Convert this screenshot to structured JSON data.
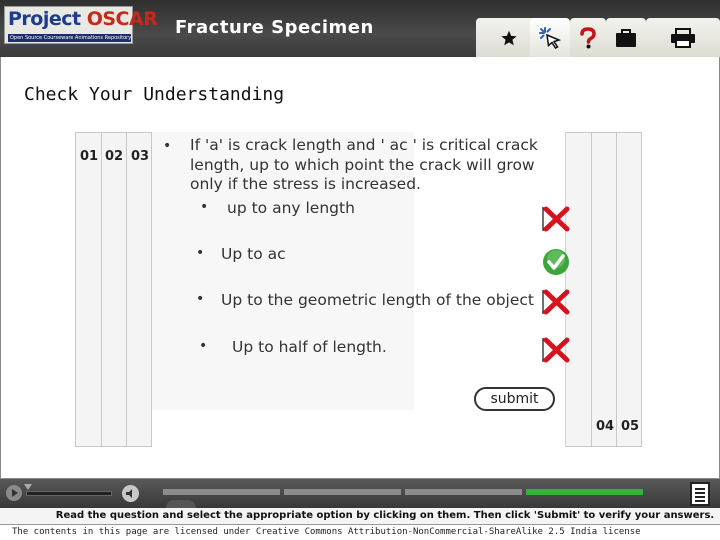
{
  "header": {
    "logo": {
      "word1": "Project",
      "word2": "OSCAR",
      "tagline": "Open Source Courseware Animations Repository"
    },
    "title": "Fracture Specimen",
    "tabs": [
      {
        "icon": "star-icon"
      },
      {
        "icon": "cursor-click-icon"
      },
      {
        "icon": "question-icon"
      },
      {
        "icon": "briefcase-icon"
      },
      {
        "icon": "printer-icon"
      }
    ]
  },
  "section_title": "Check Your Understanding",
  "question_tabs": {
    "left": [
      "01",
      "02",
      "03"
    ],
    "right": [
      "04",
      "05"
    ]
  },
  "question": {
    "text": "If 'a' is crack length and ' ac ' is critical crack length, up to which  point the crack will grow only if the stress is  increased.",
    "options": [
      {
        "label": "up to any length",
        "result": "wrong"
      },
      {
        "label": "Up to ac",
        "result": "correct"
      },
      {
        "label": "Up to the geometric length of the object",
        "result": "wrong"
      },
      {
        "label": "Up to half of length.",
        "result": "wrong"
      }
    ],
    "submit_label": "submit"
  },
  "colors": {
    "correct": "#3aa53a",
    "wrong": "#d5121e",
    "progress_done": "#36b23a"
  },
  "footer": {
    "instruction": "Read the question and select the appropriate option by clicking on them. Then click 'Submit' to verify your answers.",
    "license": "The contents in this page are licensed under Creative Commons Attribution-NonCommercial-ShareAlike 2.5 India license"
  }
}
